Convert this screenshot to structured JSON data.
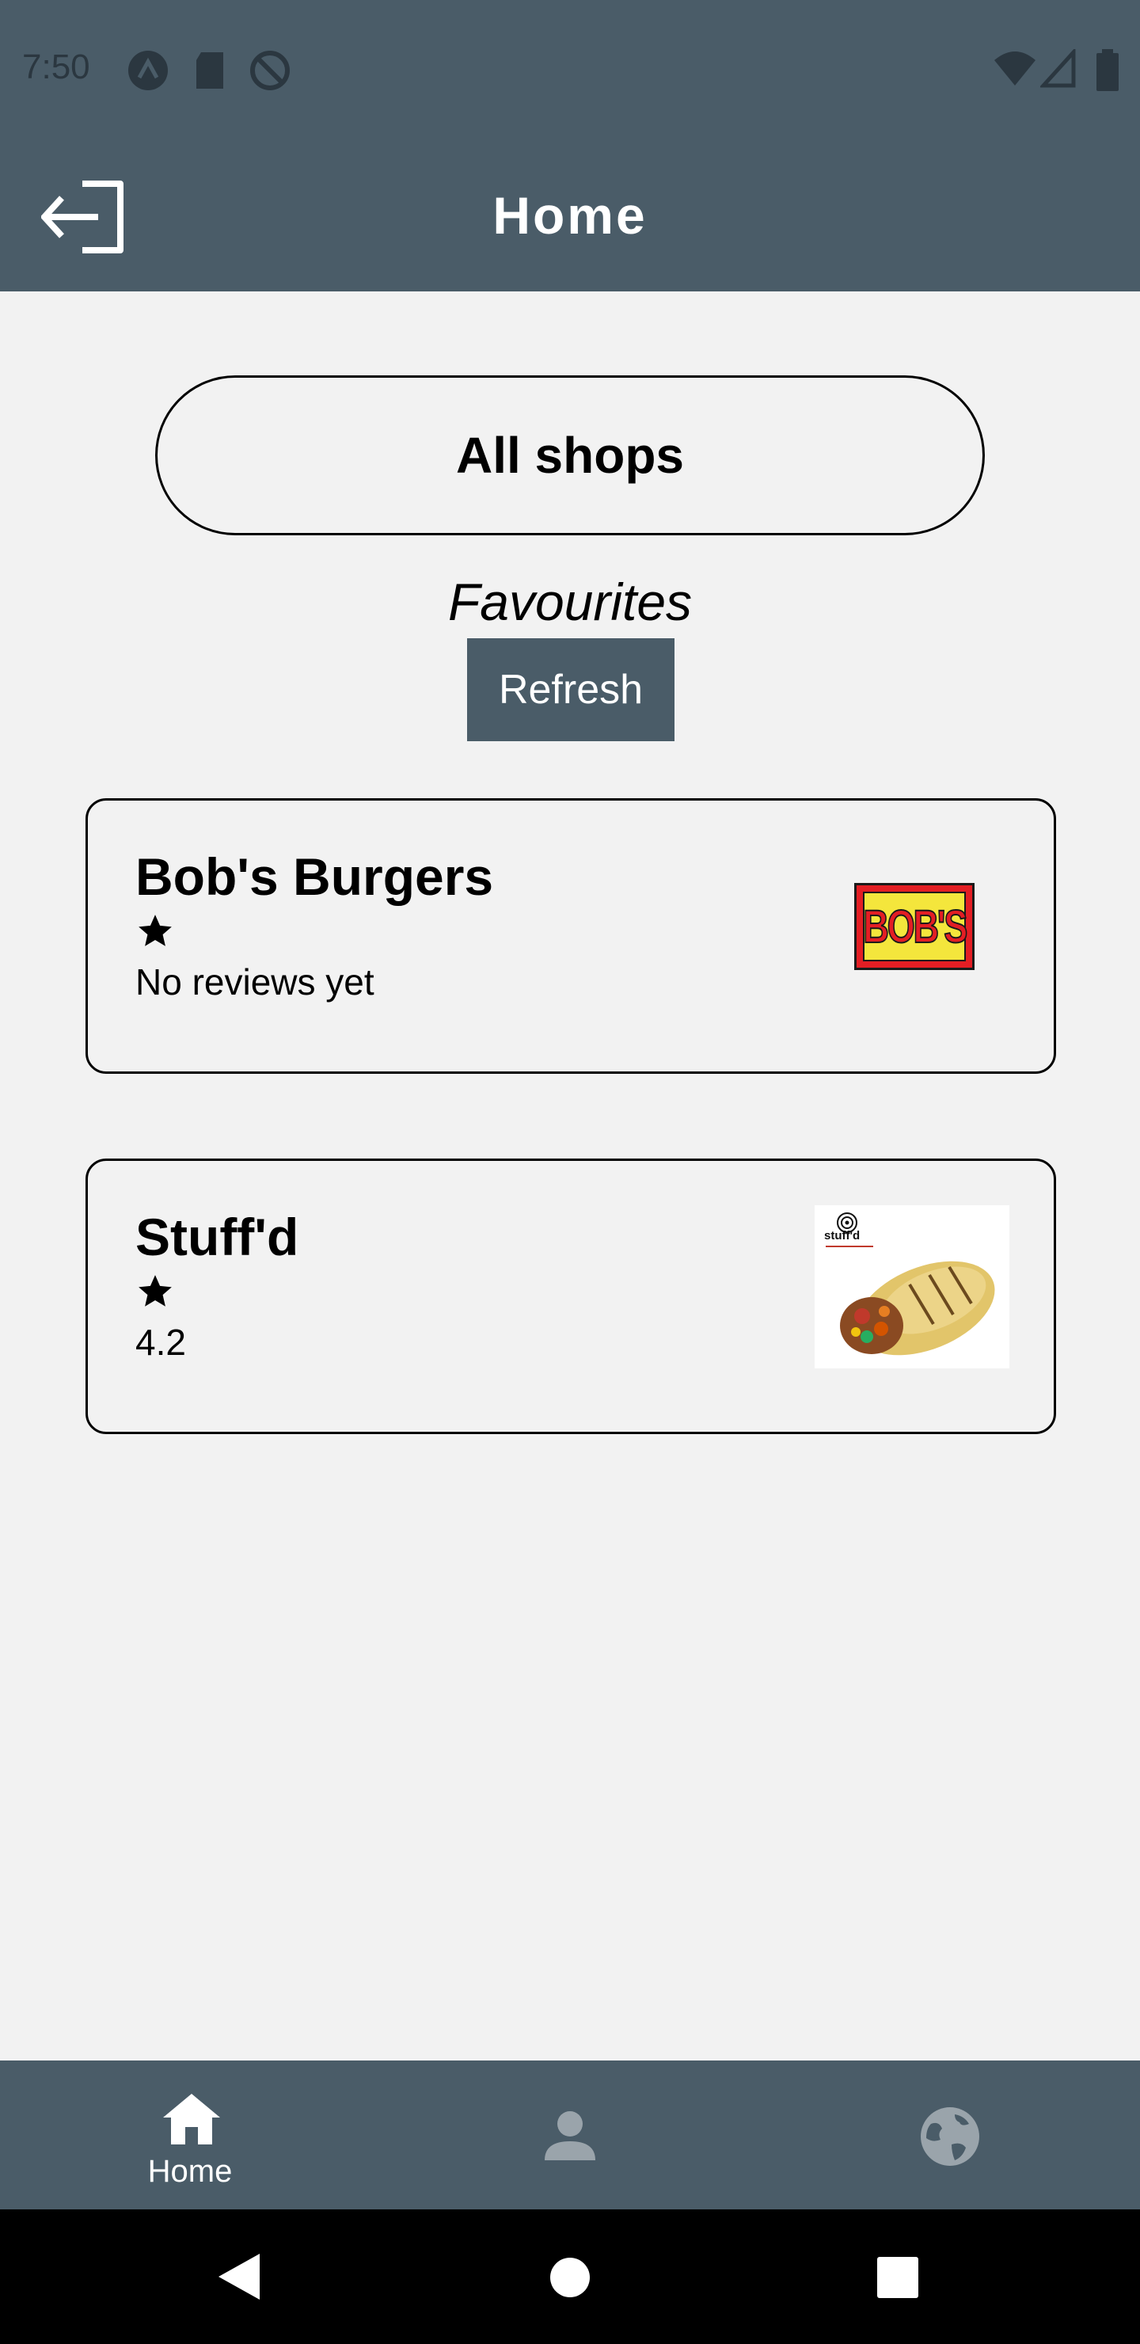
{
  "status_bar": {
    "time": "7:50"
  },
  "app_bar": {
    "title": "Home"
  },
  "main": {
    "all_shops_label": "All shops",
    "favourites_title": "Favourites",
    "refresh_label": "Refresh",
    "shops": [
      {
        "name": "Bob's Burgers",
        "rating_text": "No reviews yet",
        "logo_text": "BOB'S"
      },
      {
        "name": "Stuff'd",
        "rating_text": "4.2",
        "logo_text": "stuff'd"
      }
    ]
  },
  "bottom_nav": {
    "items": [
      {
        "label": "Home",
        "icon": "home-icon",
        "active": true
      },
      {
        "label": "",
        "icon": "person-icon",
        "active": false
      },
      {
        "label": "",
        "icon": "globe-icon",
        "active": false
      }
    ]
  },
  "colors": {
    "primary": "#4a5c68",
    "background": "#f2f2f2",
    "inactive_icon": "#9aa4ab"
  }
}
